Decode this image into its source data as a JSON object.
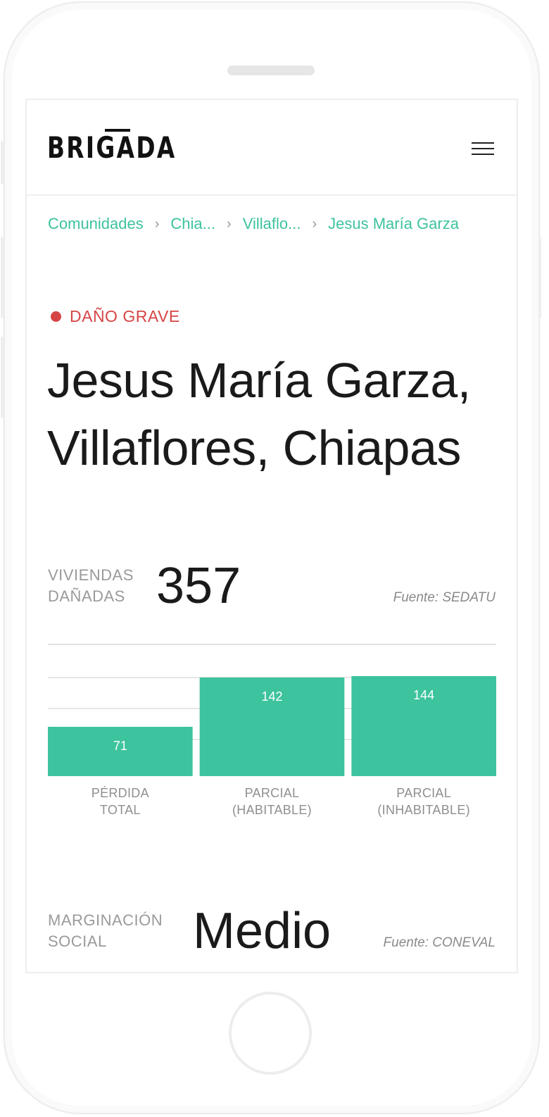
{
  "header": {
    "logo_text": "BRIGADA",
    "menu_icon": "hamburger-menu-icon"
  },
  "breadcrumb": {
    "items": [
      "Comunidades",
      "Chia...",
      "Villaflo...",
      "Jesus María Garza"
    ],
    "separator_icon": "chevron-right-icon"
  },
  "status": {
    "label": "DAÑO GRAVE",
    "color": "#d64545"
  },
  "page_title": {
    "line1": "Jesus María Garza,",
    "line2": "Villaflores, Chiapas"
  },
  "housing": {
    "label_line1": "VIVIENDAS",
    "label_line2": "DAÑADAS",
    "value": "357",
    "source": "Fuente: SEDATU"
  },
  "marginalization": {
    "label_line1": "MARGINACIÓN",
    "label_line2": "SOCIAL",
    "value": "Medio",
    "source": "Fuente: CONEVAL"
  },
  "colors": {
    "accent": "#3dc39e",
    "danger": "#d64545",
    "text": "#1a1a1a",
    "muted": "#9a9a9a"
  },
  "chart_data": {
    "type": "bar",
    "categories": [
      "PÉRDIDA TOTAL",
      "PARCIAL (HABITABLE)",
      "PARCIAL (INHABITABLE)"
    ],
    "category_lines": [
      [
        "PÉRDIDA",
        "TOTAL"
      ],
      [
        "PARCIAL",
        "(HABITABLE)"
      ],
      [
        "PARCIAL",
        "(INHABITABLE)"
      ]
    ],
    "values": [
      71,
      142,
      144
    ],
    "value_labels": [
      "71",
      "142",
      "144"
    ],
    "bar_color": "#3dc39e",
    "grid": true
  }
}
